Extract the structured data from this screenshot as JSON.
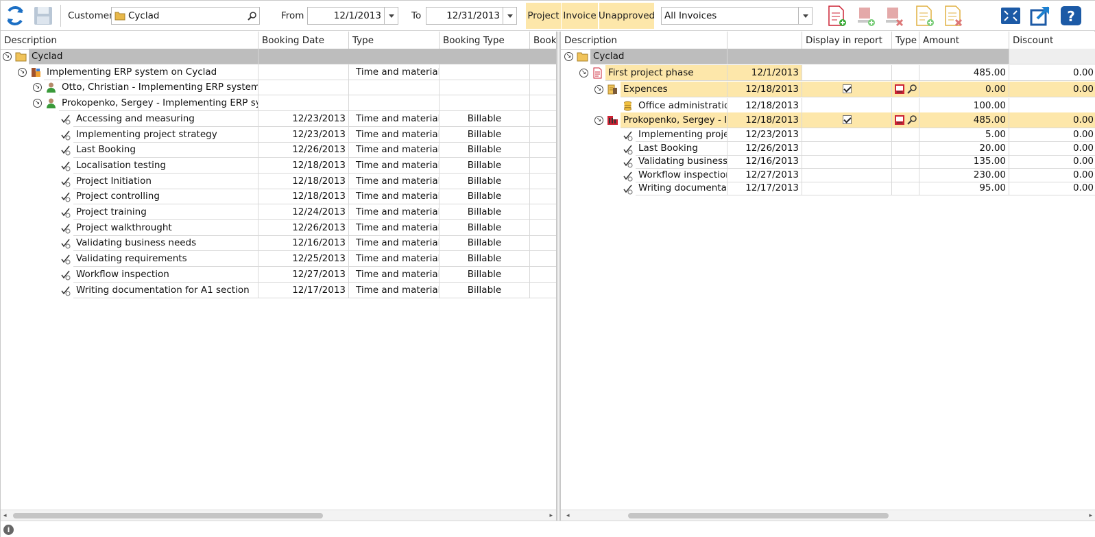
{
  "toolbar": {
    "customer_label": "Customer",
    "customer_value": "Cyclad",
    "from_label": "From",
    "from_value": "12/1/2013",
    "to_label": "To",
    "to_value": "12/31/2013",
    "filter_tabs": [
      "Project",
      "Invoice",
      "Unapproved"
    ],
    "invoice_filter_value": "All Invoices"
  },
  "left": {
    "columns": [
      "Description",
      "Booking Date",
      "Type",
      "Booking Type",
      "Booki"
    ],
    "rows": [
      {
        "level": 0,
        "icon": "folder",
        "desc": "Cyclad",
        "date": "",
        "type": "",
        "btype": "",
        "style": "grey",
        "expand": true
      },
      {
        "level": 1,
        "icon": "project",
        "desc": "Implementing ERP system on Cyclad",
        "date": "",
        "type": "Time and material",
        "btype": "",
        "style": "",
        "expand": true
      },
      {
        "level": 2,
        "icon": "user",
        "desc": "Otto, Christian - Implementing ERP system on",
        "date": "",
        "type": "",
        "btype": "",
        "style": "",
        "expand": true
      },
      {
        "level": 2,
        "icon": "user",
        "desc": "Prokopenko, Sergey - Implementing ERP syste",
        "date": "",
        "type": "",
        "btype": "",
        "style": "",
        "expand": true
      },
      {
        "level": 3,
        "icon": "task",
        "desc": "Accessing and measuring",
        "date": "12/23/2013",
        "type": "Time and material",
        "btype": "Billable",
        "style": ""
      },
      {
        "level": 3,
        "icon": "task",
        "desc": "Implementing project strategy",
        "date": "12/23/2013",
        "type": "Time and material",
        "btype": "Billable",
        "style": ""
      },
      {
        "level": 3,
        "icon": "task",
        "desc": "Last Booking",
        "date": "12/26/2013",
        "type": "Time and material",
        "btype": "Billable",
        "style": ""
      },
      {
        "level": 3,
        "icon": "task",
        "desc": "Localisation testing",
        "date": "12/18/2013",
        "type": "Time and material",
        "btype": "Billable",
        "style": ""
      },
      {
        "level": 3,
        "icon": "task",
        "desc": "Project Initiation",
        "date": "12/18/2013",
        "type": "Time and material",
        "btype": "Billable",
        "style": ""
      },
      {
        "level": 3,
        "icon": "task",
        "desc": "Project controlling",
        "date": "12/18/2013",
        "type": "Time and material",
        "btype": "Billable",
        "style": ""
      },
      {
        "level": 3,
        "icon": "task",
        "desc": "Project training",
        "date": "12/24/2013",
        "type": "Time and material",
        "btype": "Billable",
        "style": ""
      },
      {
        "level": 3,
        "icon": "task",
        "desc": "Project walkthrought",
        "date": "12/26/2013",
        "type": "Time and material",
        "btype": "Billable",
        "style": ""
      },
      {
        "level": 3,
        "icon": "task",
        "desc": "Validating business needs",
        "date": "12/16/2013",
        "type": "Time and material",
        "btype": "Billable",
        "style": ""
      },
      {
        "level": 3,
        "icon": "task",
        "desc": "Validating requirements",
        "date": "12/25/2013",
        "type": "Time and material",
        "btype": "Billable",
        "style": ""
      },
      {
        "level": 3,
        "icon": "task",
        "desc": "Workflow inspection",
        "date": "12/27/2013",
        "type": "Time and material",
        "btype": "Billable",
        "style": ""
      },
      {
        "level": 3,
        "icon": "task",
        "desc": "Writing documentation for A1 section",
        "date": "12/17/2013",
        "type": "Time and material",
        "btype": "Billable",
        "style": ""
      }
    ]
  },
  "right": {
    "columns": [
      "Description",
      "",
      "Display in report",
      "Type",
      "Amount",
      "Discount"
    ],
    "rows": [
      {
        "level": 0,
        "icon": "folder",
        "desc": "Cyclad",
        "date": "",
        "display": false,
        "typeicons": false,
        "amount": "",
        "discount": "",
        "style": "grey",
        "expand": true
      },
      {
        "level": 1,
        "icon": "invoice",
        "desc": "First project phase",
        "date": "12/1/2013",
        "display": false,
        "typeicons": false,
        "amount": "485.00",
        "discount": "0.00",
        "style": "hl1",
        "expand": true
      },
      {
        "level": 2,
        "icon": "expense",
        "desc": "Expences",
        "date": "12/18/2013",
        "display": true,
        "typeicons": true,
        "amount": "0.00",
        "discount": "0.00",
        "style": "hl2",
        "expand": true
      },
      {
        "level": 3,
        "icon": "coins",
        "desc": "Office administration",
        "date": "12/18/2013",
        "display": false,
        "typeicons": false,
        "amount": "100.00",
        "discount": "",
        "style": ""
      },
      {
        "level": 2,
        "icon": "time",
        "desc": "Prokopenko, Sergey - Im",
        "date": "12/18/2013",
        "display": true,
        "typeicons": true,
        "amount": "485.00",
        "discount": "0.00",
        "style": "hl2",
        "expand": true
      },
      {
        "level": 3,
        "icon": "task",
        "desc": "Implementing projec",
        "date": "12/23/2013",
        "display": false,
        "typeicons": false,
        "amount": "5.00",
        "discount": "0.00",
        "style": ""
      },
      {
        "level": 3,
        "icon": "task",
        "desc": "Last Booking",
        "date": "12/26/2013",
        "display": false,
        "typeicons": false,
        "amount": "20.00",
        "discount": "0.00",
        "style": ""
      },
      {
        "level": 3,
        "icon": "task",
        "desc": "Validating business n",
        "date": "12/16/2013",
        "display": false,
        "typeicons": false,
        "amount": "135.00",
        "discount": "0.00",
        "style": ""
      },
      {
        "level": 3,
        "icon": "task",
        "desc": "Workflow inspection",
        "date": "12/27/2013",
        "display": false,
        "typeicons": false,
        "amount": "230.00",
        "discount": "0.00",
        "style": ""
      },
      {
        "level": 3,
        "icon": "task",
        "desc": "Writing documentatic",
        "date": "12/17/2013",
        "display": false,
        "typeicons": false,
        "amount": "95.00",
        "discount": "0.00",
        "style": ""
      }
    ]
  },
  "icons": {
    "toolbar_left": [
      "refresh-icon",
      "save-icon"
    ],
    "toolbar_right": [
      "add-invoice-icon",
      "add-approval-icon",
      "delete-approval-icon",
      "add-invoice-line-icon",
      "delete-invoice-line-icon",
      "fullscreen-icon",
      "open-external-icon",
      "help-icon"
    ],
    "status": "info-icon"
  },
  "colors": {
    "highlight": "#fde7aa",
    "group_row": "#bdbdbd",
    "accent_blue": "#1c5aa6"
  }
}
